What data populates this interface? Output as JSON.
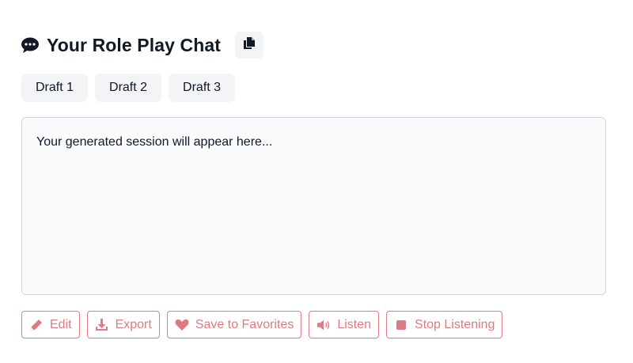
{
  "header": {
    "title": "Your Role Play Chat",
    "icon": "speech-bubble-icon",
    "copy_icon": "copy-icon"
  },
  "tabs": [
    {
      "label": "Draft 1"
    },
    {
      "label": "Draft 2"
    },
    {
      "label": "Draft 3"
    }
  ],
  "output": {
    "placeholder_text": "Your generated session will appear here..."
  },
  "actions": [
    {
      "label": "Edit",
      "icon": "pencil-icon"
    },
    {
      "label": "Export",
      "icon": "download-icon"
    },
    {
      "label": "Save to Favorites",
      "icon": "heart-icon"
    },
    {
      "label": "Listen",
      "icon": "speaker-icon"
    },
    {
      "label": "Stop Listening",
      "icon": "stop-icon"
    }
  ],
  "colors": {
    "accent": "#de7a83",
    "tab_bg": "#f3f4f6",
    "output_bg": "#f9fafb",
    "text": "#111827"
  }
}
